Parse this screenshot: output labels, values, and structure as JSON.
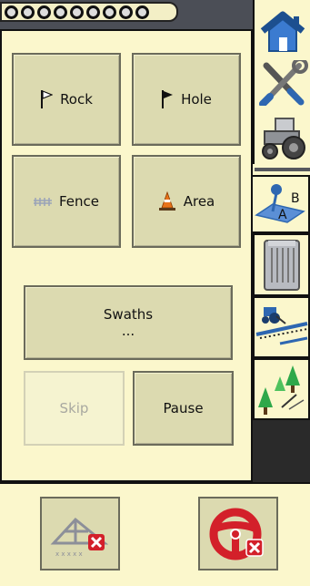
{
  "progress_dots_count": 9,
  "buttons": {
    "rock": "Rock",
    "hole": "Hole",
    "fence": "Fence",
    "area": "Area",
    "swaths": "Swaths",
    "swaths_sub": "...",
    "skip": "Skip",
    "pause": "Pause"
  },
  "sidebar": {
    "home_icon": "house-icon",
    "tools_icon": "wrench-screwdriver-icon",
    "tractor_icon": "tractor-icon",
    "ab_label_a": "A",
    "ab_label_b": "B"
  },
  "colors": {
    "panel": "#fbf7cc",
    "button": "#dcdab0",
    "dark": "#2a2a2a",
    "accent_red": "#d3202a",
    "accent_blue": "#2e67b1"
  }
}
